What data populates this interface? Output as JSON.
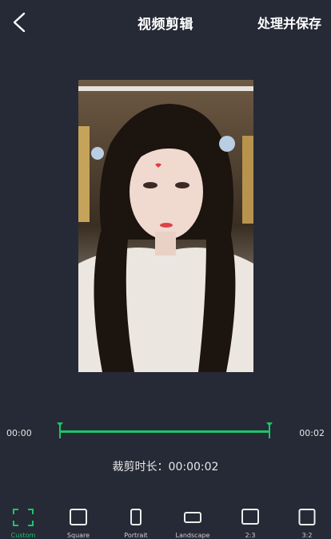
{
  "header": {
    "back_icon": "chevron-left-icon",
    "title": "视频剪辑",
    "save_label": "处理并保存"
  },
  "timeline": {
    "start_time": "00:00",
    "end_time": "00:02",
    "accent_color": "#1dc46a"
  },
  "duration": {
    "text": "裁剪时长：00:00:02"
  },
  "ratios": {
    "items": [
      {
        "label": "Custom",
        "icon": "crop-corners-icon",
        "active": true
      },
      {
        "label": "Square",
        "icon": "square-icon"
      },
      {
        "label": "Portrait",
        "icon": "portrait-rect-icon"
      },
      {
        "label": "Landscape",
        "icon": "landscape-rect-icon"
      },
      {
        "label": "2:3",
        "icon": "ratio-2-3-icon"
      },
      {
        "label": "3:2",
        "icon": "ratio-3-2-icon"
      }
    ]
  },
  "colors": {
    "background": "#262a36",
    "accent": "#1dc46a"
  }
}
